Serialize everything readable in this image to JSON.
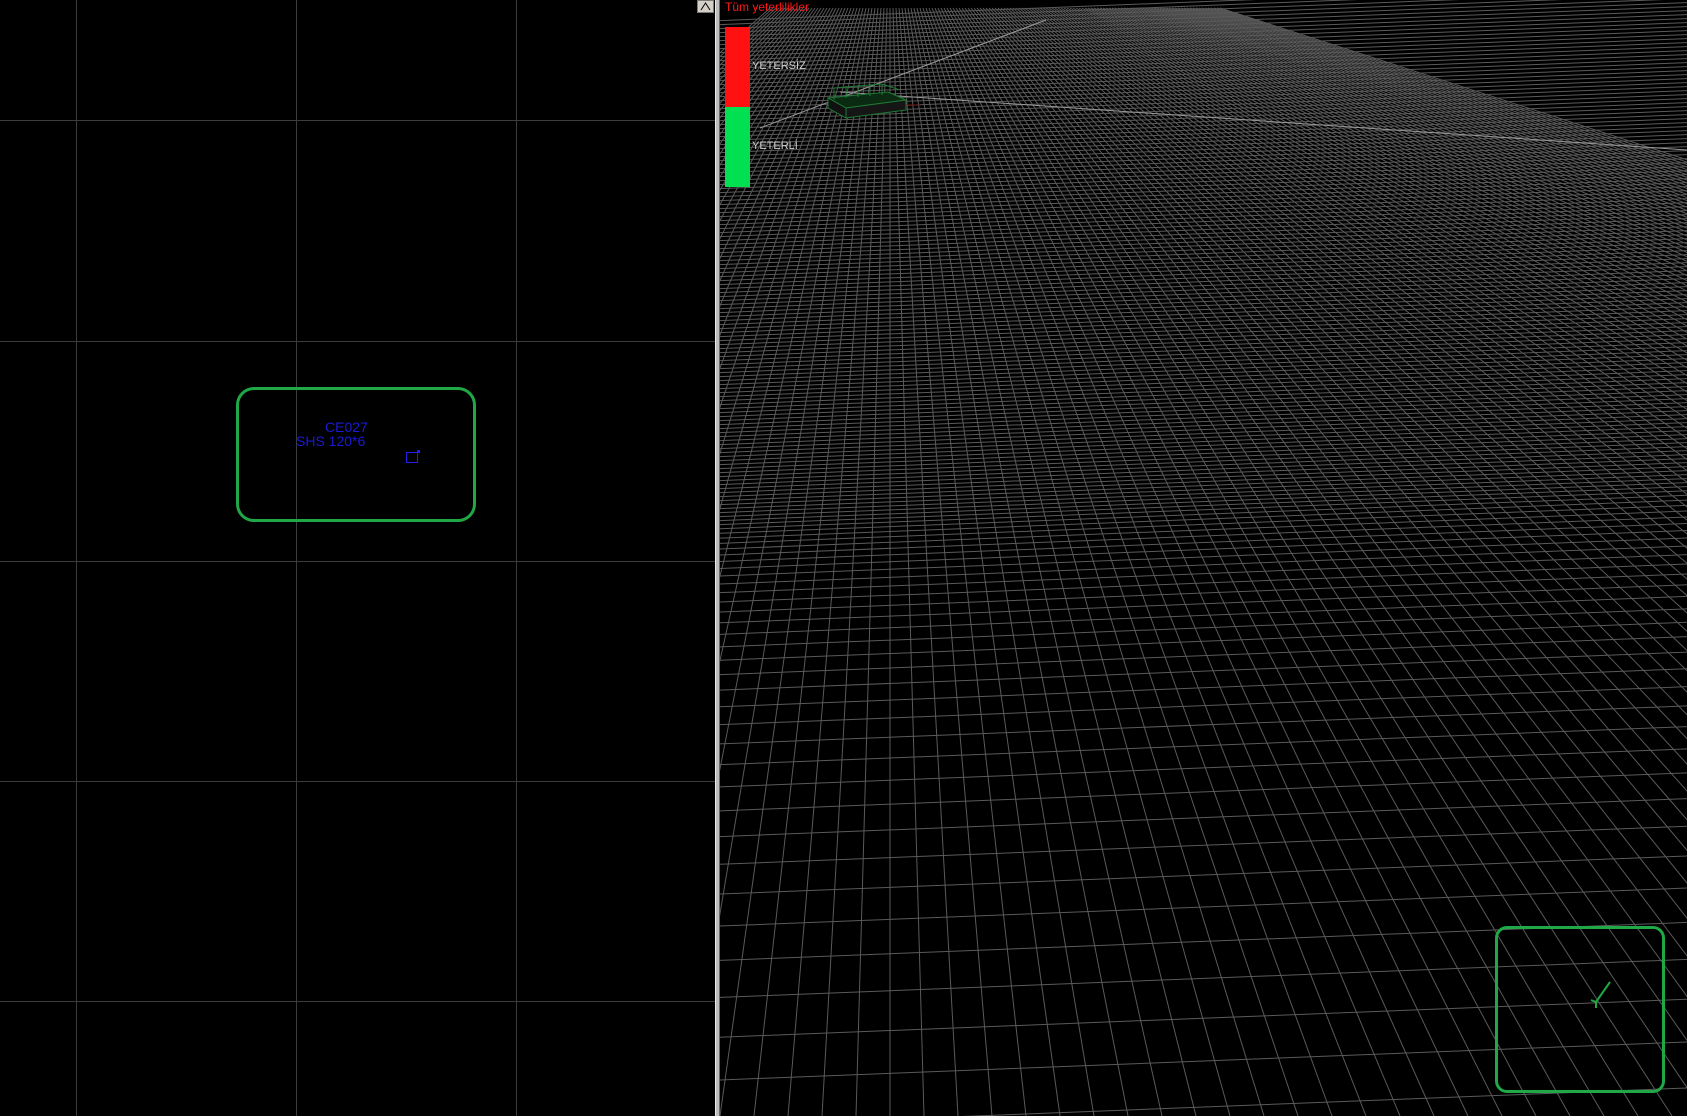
{
  "plan_view": {
    "member": {
      "code": "CE027",
      "section": "SHS 120*6"
    },
    "collapse_button_icon": "caret-up-icon"
  },
  "viewport_3d": {
    "legend": {
      "title": "Tüm yeterlilikler",
      "items": [
        {
          "label": "YETERSİZ",
          "color": "#ff1111"
        },
        {
          "label": "YETERLİ",
          "color": "#00e050"
        }
      ]
    },
    "viewcube_icon": "axis-tripod-icon"
  },
  "colors": {
    "background": "#000000",
    "plan_grid": "#3c3c3c",
    "floor_grid": "#5a5a5a",
    "highlight_frame": "#1fa845",
    "member_text": "#1a1ad8",
    "legend_title": "#ff1a1a",
    "legend_text": "#cfcfcf"
  }
}
